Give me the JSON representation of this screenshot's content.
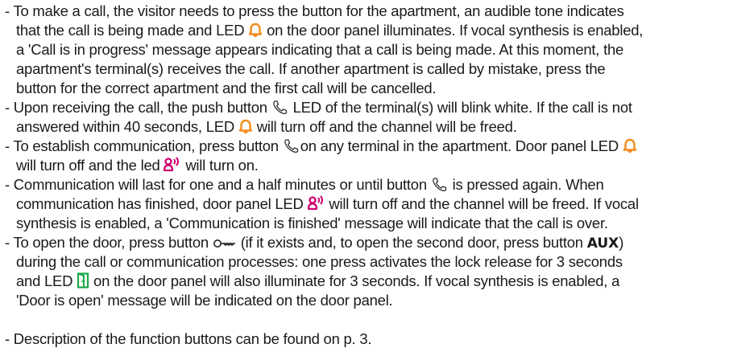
{
  "colors": {
    "text": "#1a1a1a",
    "bell_icon": "#f28c1e",
    "speaker_icon": "#d0006f",
    "door_icon": "#1aaa4b"
  },
  "icons": {
    "bell": "bell-led-icon",
    "phone": "handset-icon",
    "speaker": "talk-led-icon",
    "key": "key-icon",
    "door": "door-open-led-icon"
  },
  "aux_label": "AUX",
  "p1": {
    "l1": "- To make a call, the visitor needs to press the button for the apartment, an audible tone indicates",
    "l2a": "that the call is being made and LED",
    "l2b": "on the door panel illuminates. If vocal synthesis is enabled,",
    "l3": "a 'Call is in progress' message appears indicating that a call is being made. At this moment, the",
    "l4": "apartment's terminal(s) receives the call. If another apartment is called by mistake, press the",
    "l5": "button for the correct apartment and the first call will be cancelled."
  },
  "p2": {
    "l1a": "- Upon receiving the call, the push button",
    "l1b": "LED of the terminal(s) will blink white. If the call is not",
    "l2a": "answered within 40 seconds, LED",
    "l2b": "will turn off and the channel will be freed."
  },
  "p3": {
    "l1a": "- To establish communication, press button",
    "l1b": "on any terminal in the apartment. Door panel LED",
    "l2a": "will turn off and the led",
    "l2b": "will turn on."
  },
  "p4": {
    "l1a": "- Communication will last for one and a half minutes or until button",
    "l1b": "is pressed again. When",
    "l2a": "communication has finished, door panel LED",
    "l2b": "will turn off and the channel will be freed. If vocal",
    "l3": "synthesis is enabled, a 'Communication is finished' message will indicate that the call is over."
  },
  "p5": {
    "l1a": "- To open the door, press button",
    "l1b": "(if it exists and, to open the second door, press button",
    "l1c": ")",
    "l2": "during the call or communication processes: one press activates the lock release for 3 seconds",
    "l3a": "and LED",
    "l3b": "on the door panel will also illuminate for 3 seconds. If vocal synthesis is enabled, a",
    "l4": "'Door is open' message will be indicated on the door panel."
  },
  "p6": {
    "l1": "- Description of the function buttons can be found on p. 3."
  }
}
